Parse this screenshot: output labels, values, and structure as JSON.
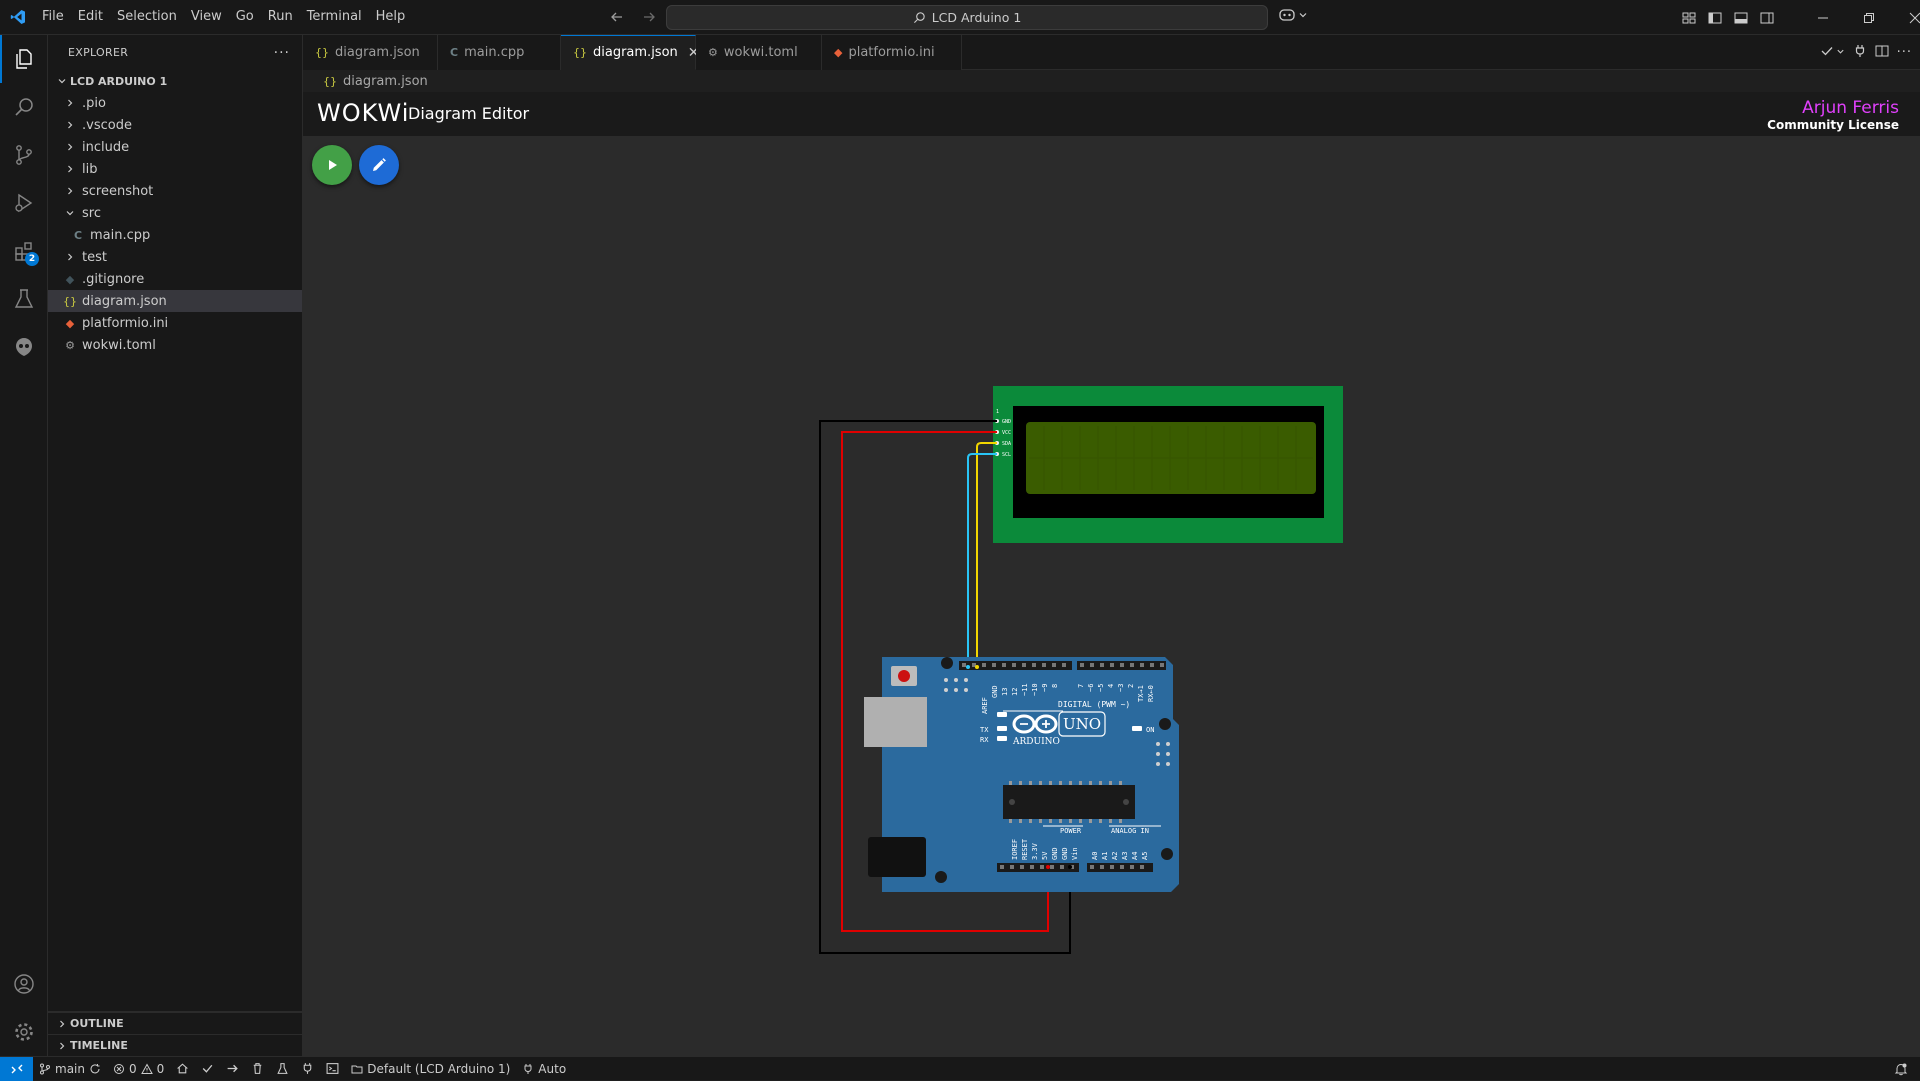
{
  "menu": [
    "File",
    "Edit",
    "Selection",
    "View",
    "Go",
    "Run",
    "Terminal",
    "Help"
  ],
  "command_center": {
    "label": "LCD Arduino 1"
  },
  "explorer": {
    "title": "EXPLORER",
    "project": "LCD ARDUINO 1",
    "items": [
      {
        "label": ".pio",
        "kind": "folder",
        "icon": "chevron-right-icon"
      },
      {
        "label": ".vscode",
        "kind": "folder",
        "icon": "chevron-right-icon"
      },
      {
        "label": "include",
        "kind": "folder",
        "icon": "chevron-right-icon"
      },
      {
        "label": "lib",
        "kind": "folder",
        "icon": "chevron-right-icon"
      },
      {
        "label": "screenshot",
        "kind": "folder",
        "icon": "chevron-right-icon"
      },
      {
        "label": "src",
        "kind": "folder-open",
        "icon": "chevron-down-icon"
      },
      {
        "label": "main.cpp",
        "kind": "cpp-file",
        "icon": "cpp-file-icon"
      },
      {
        "label": "test",
        "kind": "folder",
        "icon": "chevron-right-icon"
      },
      {
        "label": ".gitignore",
        "kind": "git-file",
        "icon": "gitignore-icon"
      },
      {
        "label": "diagram.json",
        "kind": "json-file",
        "icon": "json-file-icon"
      },
      {
        "label": "platformio.ini",
        "kind": "ini-file",
        "icon": "platformio-icon"
      },
      {
        "label": "wokwi.toml",
        "kind": "toml-file",
        "icon": "gear-file-icon"
      }
    ],
    "outline": "OUTLINE",
    "timeline": "TIMELINE"
  },
  "tabs": [
    {
      "label": "diagram.json",
      "icon": "{}",
      "active": false
    },
    {
      "label": "main.cpp",
      "icon": "C",
      "active": false
    },
    {
      "label": "diagram.json",
      "icon": "{}",
      "active": true
    },
    {
      "label": "wokwi.toml",
      "icon": "⚙",
      "active": false
    },
    {
      "label": "platformio.ini",
      "icon": "◆",
      "active": false
    }
  ],
  "breadcrumb": "diagram.json",
  "wokwi": {
    "logo": "WOKWi",
    "title": "Diagram Editor",
    "license_name": "Arjun Ferris",
    "license_type": "Community License"
  },
  "lcd": {
    "pins": [
      "GND",
      "VCC",
      "SDA",
      "SCL"
    ],
    "pin_header": "1"
  },
  "arduino": {
    "brand": "ARDUINO",
    "model": "UNO",
    "digital_label": "DIGITAL (PWM ~)",
    "digital_pins": [
      "AREF",
      "GND",
      "13",
      "12",
      "~11",
      "~10",
      "~9",
      "8",
      "7",
      "~6",
      "~5",
      "4",
      "~3",
      "2",
      "TX→1",
      "RX←0"
    ],
    "power_label": "POWER",
    "power_pins": [
      "IOREF",
      "RESET",
      "3.3V",
      "5V",
      "GND",
      "GND",
      "Vin"
    ],
    "analog_label": "ANALOG IN",
    "analog_pins": [
      "A0",
      "A1",
      "A2",
      "A3",
      "A4",
      "A5"
    ],
    "tx": "TX",
    "rx": "RX",
    "on": "ON",
    "l": "L"
  },
  "status": {
    "branch": "main",
    "errors": "0",
    "warnings": "0",
    "env": "Default (LCD Arduino 1)",
    "auto": "Auto"
  },
  "colors": {
    "accent": "#0078d4",
    "wire_gnd": "#000000",
    "wire_vcc": "#e00000",
    "wire_sda": "#f2d600",
    "wire_scl": "#29c5f6",
    "lcd_board": "#0b8a3a",
    "lcd_screen": "#3a5c00",
    "arduino_board": "#2b6a9e",
    "license_name": "#e040fb"
  }
}
